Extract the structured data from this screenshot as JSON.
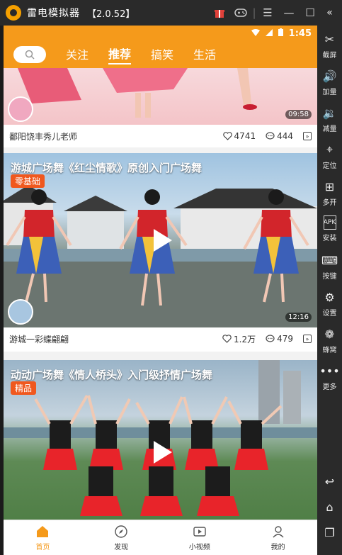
{
  "emulator": {
    "title": "雷电模拟器",
    "version": "【2.0.52】"
  },
  "statusbar": {
    "time": "1:45"
  },
  "top_tabs": [
    "关注",
    "推荐",
    "搞笑",
    "生活"
  ],
  "cards": [
    {
      "title": "",
      "duration": "09:58",
      "author": "鄱阳饶丰秀儿老师",
      "likes": "4741",
      "comments": "444"
    },
    {
      "title": "游城广场舞《红尘情歌》原创入门广场舞",
      "tag": "零基础",
      "duration": "12:16",
      "author": "游城一彩蝶翩翩",
      "likes": "1.2万",
      "comments": "479"
    },
    {
      "title": "动动广场舞《情人桥头》入门级抒情广场舞",
      "tag": "精品"
    }
  ],
  "bottom_nav": [
    "首页",
    "发现",
    "小视频",
    "我的"
  ],
  "sidebar": [
    "截屏",
    "加量",
    "减量",
    "定位",
    "多开",
    "安装",
    "按键",
    "设置",
    "蜂窝",
    "更多"
  ],
  "colors": {
    "accent": "#f59a1b",
    "tag": "#f0581e",
    "chrome": "#2a2a2a"
  }
}
